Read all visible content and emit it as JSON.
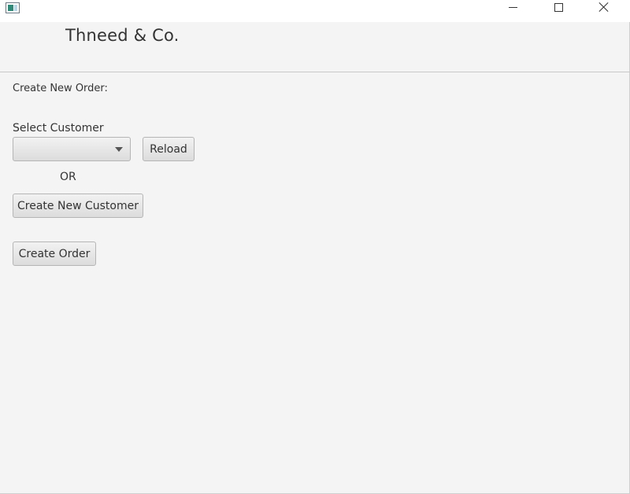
{
  "window": {
    "minimize_icon": "minimize-icon",
    "maximize_icon": "maximize-icon",
    "close_icon": "close-icon"
  },
  "header": {
    "brand": "Thneed & Co."
  },
  "form": {
    "section_title": "Create New Order:",
    "select_customer_label": "Select Customer",
    "customer_select_value": "",
    "reload_label": "Reload",
    "or_label": "OR",
    "create_customer_label": "Create New Customer",
    "create_order_label": "Create Order"
  },
  "colors": {
    "window_background": "#f4f4f4",
    "button_gradient_top": "#f2f2f2",
    "button_gradient_bottom": "#dcdcdc",
    "text": "#333333"
  }
}
